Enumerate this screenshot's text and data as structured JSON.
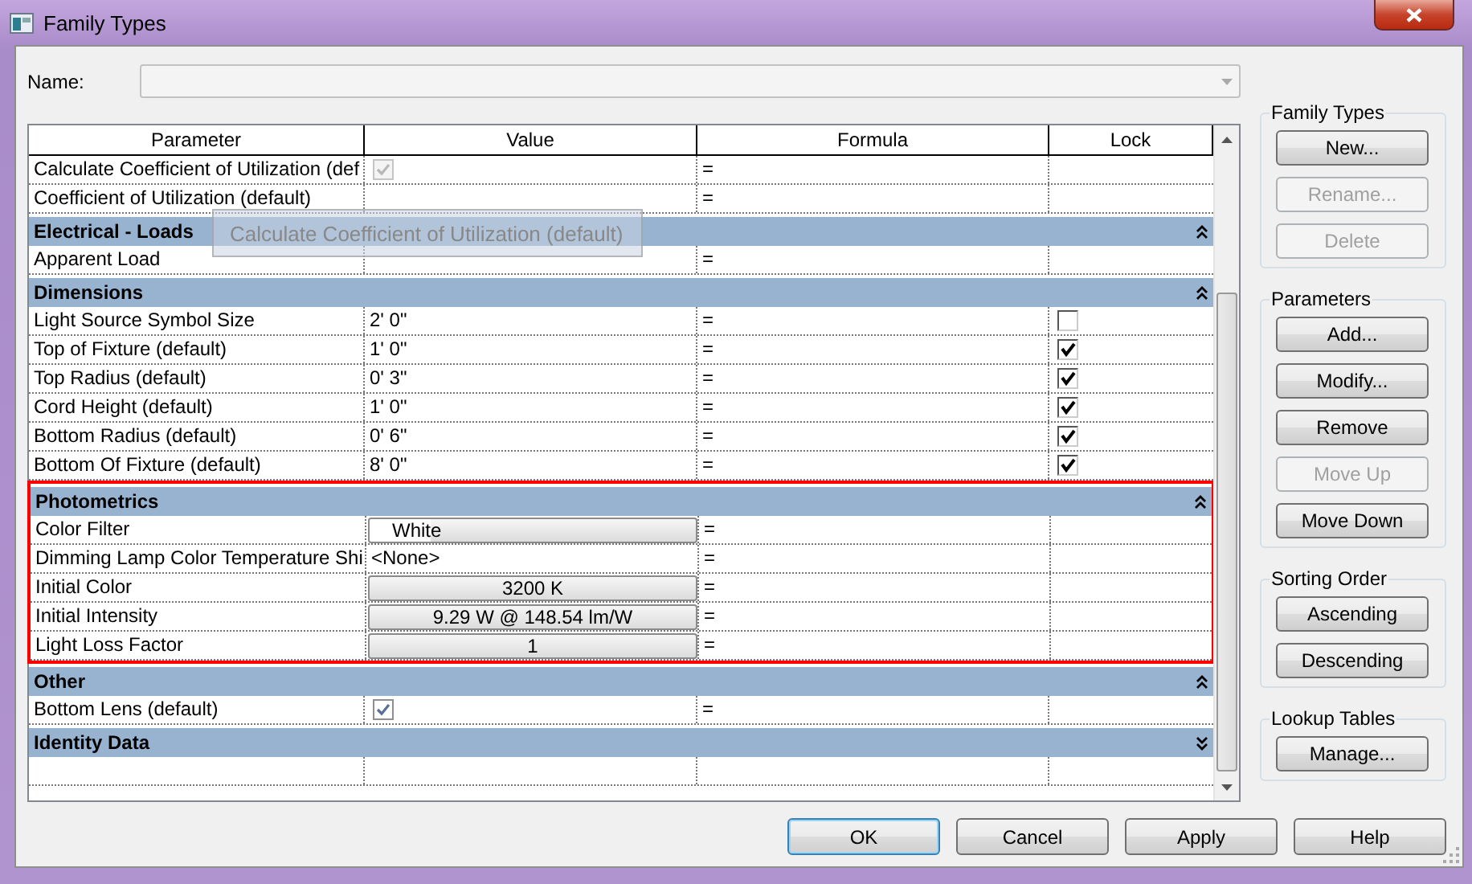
{
  "window": {
    "title": "Family Types"
  },
  "name_field": {
    "label": "Name:"
  },
  "grid": {
    "columns": [
      "Parameter",
      "Value",
      "Formula",
      "Lock"
    ],
    "sections": [
      {
        "highlighted": false,
        "rows": [
          {
            "name": "Calculate Coefficient of Utilization (def",
            "kind": "checkbox",
            "checked": true,
            "disabled": true,
            "formula": "="
          },
          {
            "name": "Coefficient of Utilization (default)",
            "kind": "text",
            "formula": "="
          }
        ]
      },
      {
        "header": "Electrical - Loads",
        "expanded": true,
        "highlighted": false,
        "rows": [
          {
            "name": "Apparent Load",
            "kind": "text",
            "formula": "="
          }
        ]
      },
      {
        "header": "Dimensions",
        "expanded": true,
        "highlighted": false,
        "rows": [
          {
            "name": "Light Source Symbol Size",
            "kind": "text",
            "value": "2'  0\"",
            "formula": "=",
            "lock": false
          },
          {
            "name": "Top of Fixture (default)",
            "kind": "text",
            "value": "1'  0\"",
            "formula": "=",
            "lock": true
          },
          {
            "name": "Top Radius (default)",
            "kind": "text",
            "value": "0'  3\"",
            "formula": "=",
            "lock": true
          },
          {
            "name": "Cord Height (default)",
            "kind": "text",
            "value": "1'  0\"",
            "formula": "=",
            "lock": true
          },
          {
            "name": "Bottom Radius (default)",
            "kind": "text",
            "value": "0'  6\"",
            "formula": "=",
            "lock": true
          },
          {
            "name": "Bottom Of Fixture (default)",
            "kind": "text",
            "value": "8'  0\"",
            "formula": "=",
            "lock": true
          }
        ]
      },
      {
        "header": "Photometrics",
        "expanded": true,
        "highlighted": true,
        "rows": [
          {
            "name": "Color Filter",
            "kind": "swatch",
            "value": "White",
            "formula": "="
          },
          {
            "name": "Dimming Lamp Color Temperature Shi",
            "kind": "text",
            "value": "<None>",
            "formula": "="
          },
          {
            "name": "Initial Color",
            "kind": "button",
            "value": "3200 K",
            "formula": "="
          },
          {
            "name": "Initial Intensity",
            "kind": "button",
            "value": "9.29 W @ 148.54 lm/W",
            "formula": "="
          },
          {
            "name": "Light Loss Factor",
            "kind": "button",
            "value": "1",
            "formula": "="
          }
        ]
      },
      {
        "header": "Other",
        "expanded": true,
        "highlighted": false,
        "rows": [
          {
            "name": "Bottom Lens (default)",
            "kind": "checkbox",
            "checked": true,
            "disabled": false,
            "formula": "="
          }
        ]
      },
      {
        "header": "Identity Data",
        "expanded": false,
        "highlighted": false
      }
    ],
    "drag_ghost": {
      "label": "Calculate Coefficient of Utilization (default)"
    }
  },
  "side_groups": [
    {
      "title": "Family Types",
      "buttons": [
        {
          "label": "New...",
          "disabled": false
        },
        {
          "label": "Rename...",
          "disabled": true
        },
        {
          "label": "Delete",
          "disabled": true
        }
      ]
    },
    {
      "title": "Parameters",
      "buttons": [
        {
          "label": "Add...",
          "disabled": false
        },
        {
          "label": "Modify...",
          "disabled": false
        },
        {
          "label": "Remove",
          "disabled": false
        },
        {
          "label": "Move Up",
          "disabled": true
        },
        {
          "label": "Move Down",
          "disabled": false
        }
      ]
    },
    {
      "title": "Sorting Order",
      "buttons": [
        {
          "label": "Ascending",
          "disabled": false
        },
        {
          "label": "Descending",
          "disabled": false
        }
      ]
    },
    {
      "title": "Lookup Tables",
      "buttons": [
        {
          "label": "Manage...",
          "disabled": false
        }
      ]
    }
  ],
  "footer_buttons": [
    {
      "label": "OK",
      "default": true
    },
    {
      "label": "Cancel",
      "default": false
    },
    {
      "label": "Apply",
      "default": false
    },
    {
      "label": "Help",
      "default": false
    }
  ]
}
